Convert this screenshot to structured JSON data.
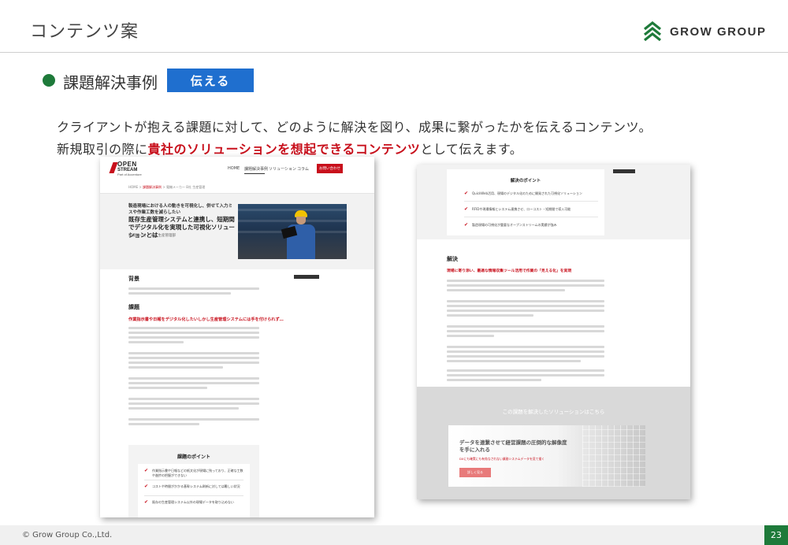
{
  "header": {
    "title": "コンテンツ案",
    "logo_text": "GROW GROUP"
  },
  "section": {
    "title": "課題解決事例",
    "tag": "伝える"
  },
  "description": {
    "line1": "クライアントが抱える課題に対して、どのように解決を図り、成果に繋がったかを伝えるコンテンツ。",
    "line2_prefix": "新規取引の際に",
    "line2_highlight": "貴社のソリューションを想起できるコンテンツ",
    "line2_suffix": "として伝えます。"
  },
  "mock_left": {
    "brand_line1": "OPEN",
    "brand_line2": "STREAM",
    "brand_line3": "Part of Accenture",
    "nav": [
      "HOME",
      "課題解決事例",
      "ソリューション",
      "コラム"
    ],
    "cta": "お問い合わせ",
    "breadcrumb_home": "HOME",
    "breadcrumb_mid": "課題解決事例",
    "breadcrumb_current": "電機メーカー B社 生産管理",
    "hero_sub": "製造現場における人の動きを可視化し、併せて入力ミスや作業工数を減らしたい",
    "hero_title": "既存生産管理システムと連携し、短期間でデジタル化を実現した可視化ソリューションとは",
    "hero_meta": "電機メーカー B社 生産管理部",
    "h_background": "背景",
    "h_problem": "課題",
    "problem_lead": "作業指示書や日報をデジタル化したいしかし生産管理システムには手を付けられず…",
    "points_title": "課題のポイント",
    "points": [
      "作業指示書や日報などの紙文化が現場に残っており、正確な工数や進捗の把握ができない",
      "コストや時間がかかる基幹システム刷新に対しては難しい状況",
      "既存の生産管理システム以外の現場データを取り込めない"
    ]
  },
  "mock_right": {
    "points_title": "解決のポイント",
    "points": [
      "QuickWeb活用、現場のデジタル化のために開発された可視化ソリューション",
      "RFIDや現場情報とシステム連携させ、ローコスト・短期間で導入可能",
      "製造現場の可視化が重要なオープンストリームの実績が強み"
    ],
    "h_solution": "解決",
    "solution_lead": "現場に寄り添い、最適な情報収集ツール活用で作業の「見える化」を実現",
    "solution_banner_caption": "この課題を解決したソリューションはこちら",
    "banner_title": "データを連繋させて経営課題の圧倒的な解像度を手に入れる",
    "banner_sub": "DXにも確実にも有効なされない業務システムデータを見て描く",
    "banner_button": "詳しく見る"
  },
  "footer": {
    "copyright": "© Grow Group Co.,Ltd.",
    "page_number": "23"
  },
  "colors": {
    "brand_green": "#1e7a3a",
    "tag_blue": "#1f6fcf",
    "highlight_red": "#c8101c"
  }
}
